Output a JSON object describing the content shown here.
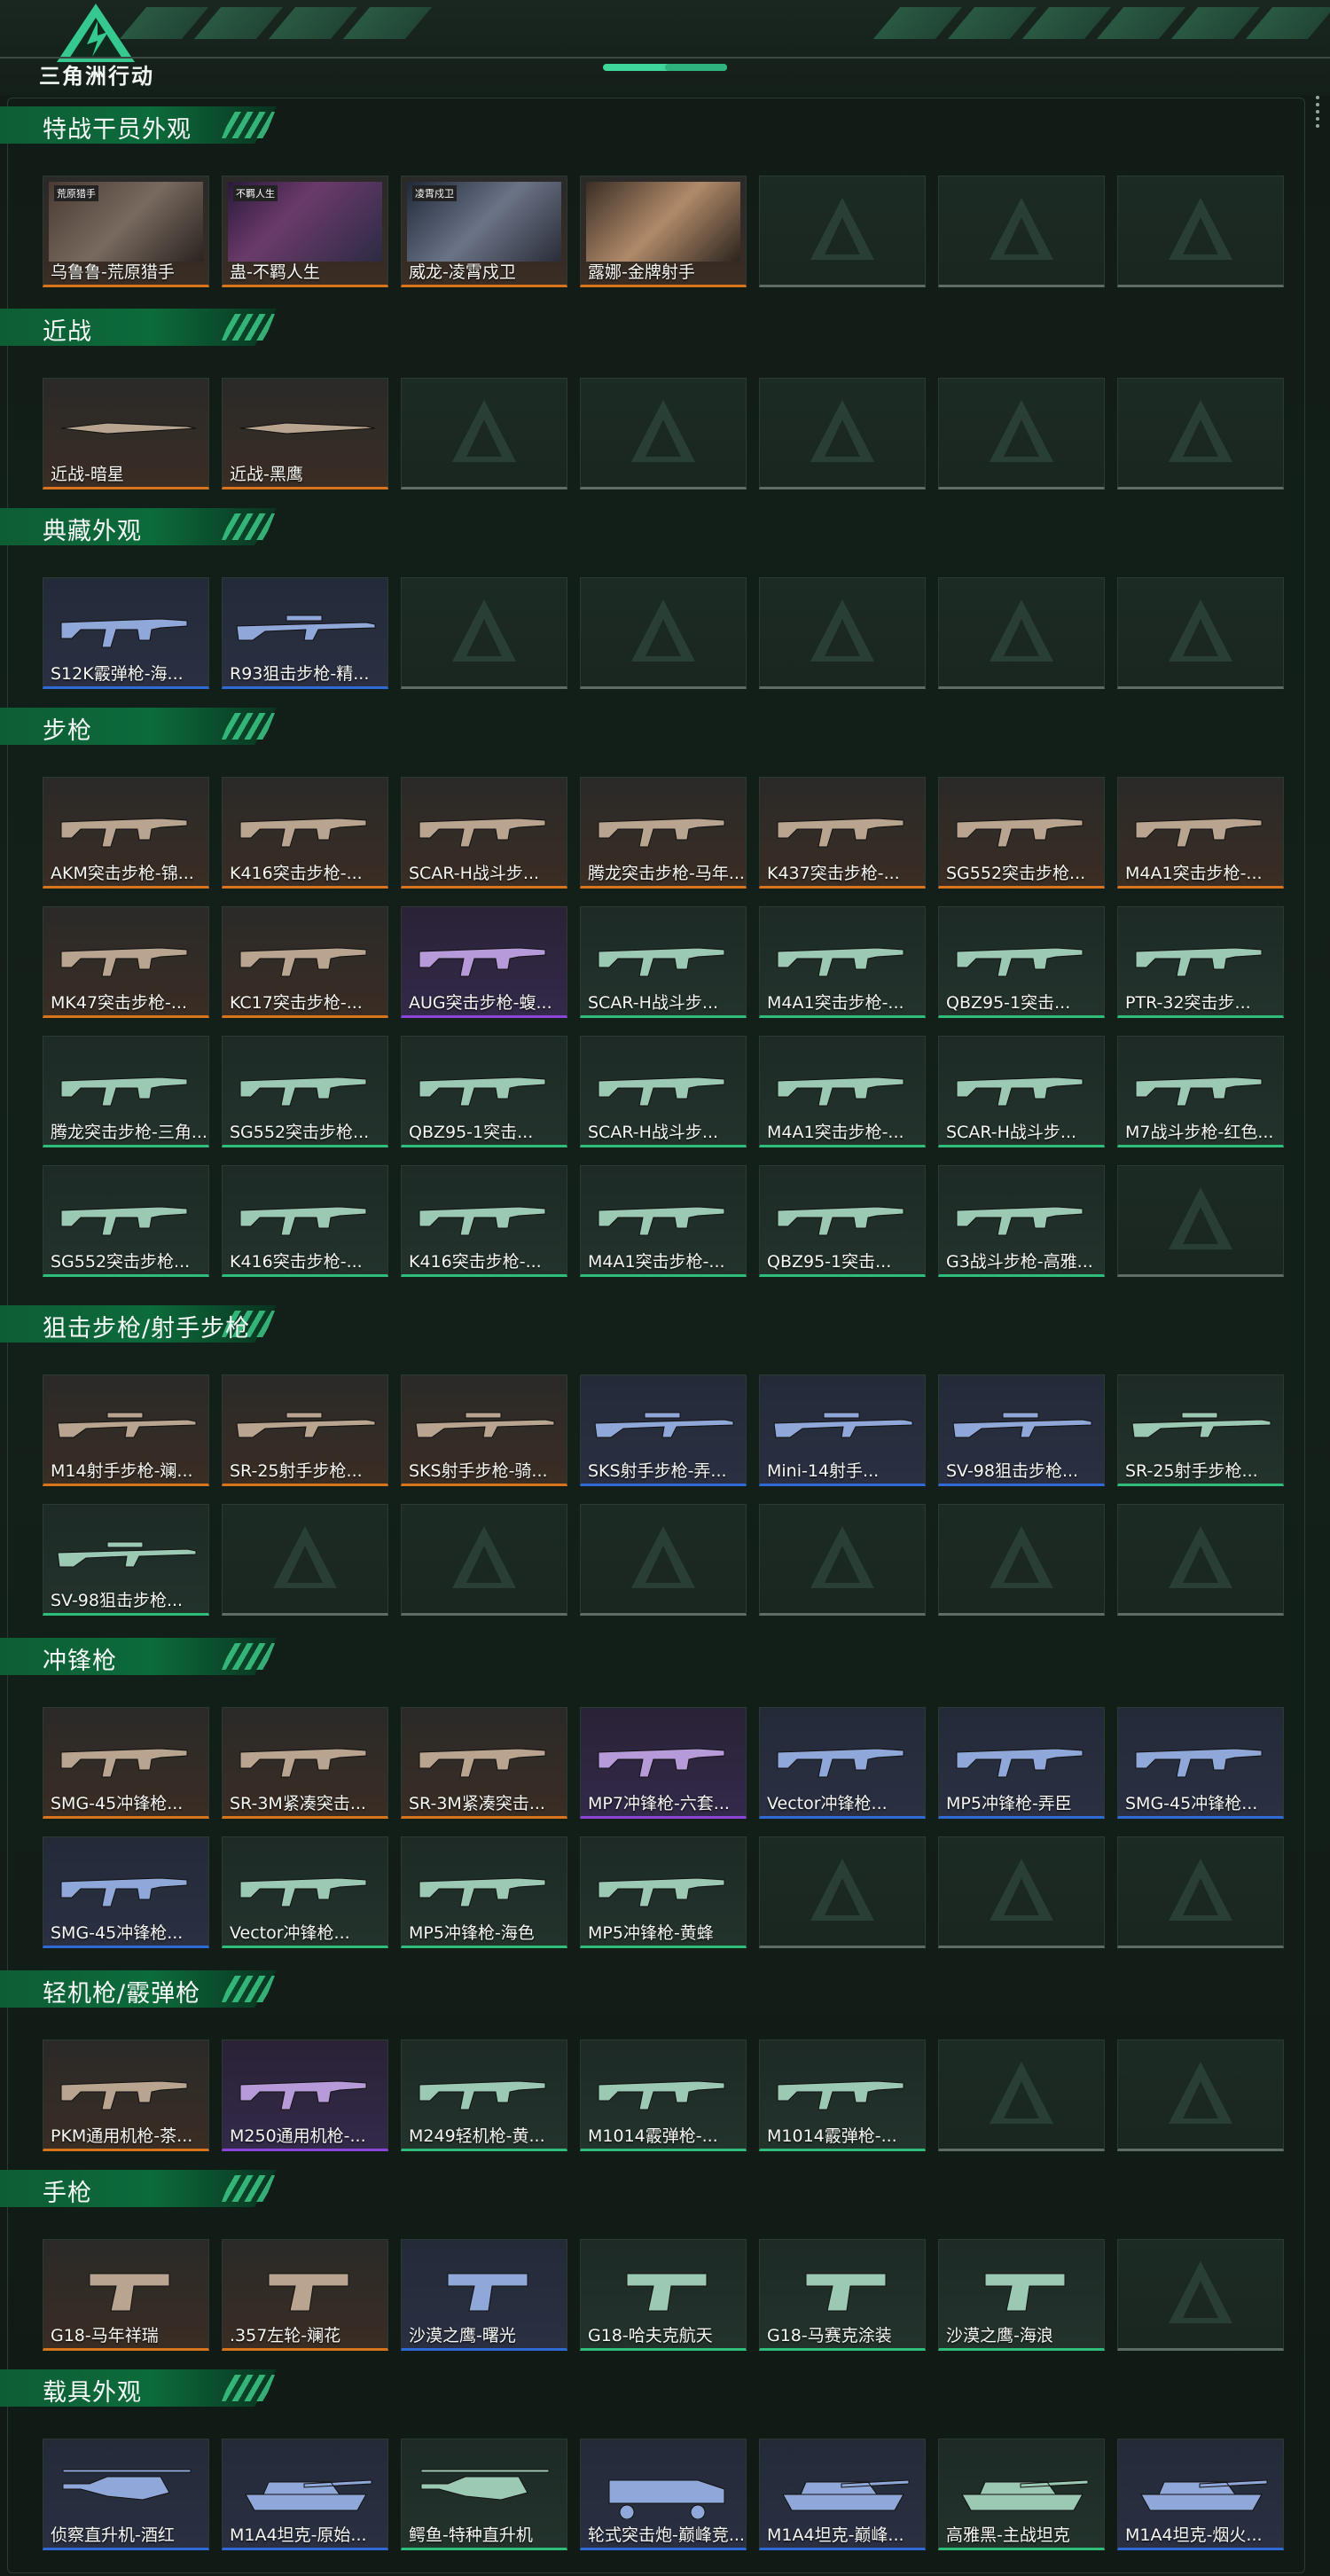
{
  "header": {
    "game_title": "三角洲行动"
  },
  "colors": {
    "orange": "#d8741c",
    "blue": "#2f6ad7",
    "green": "#2ebd7a",
    "purple": "#8b46d8",
    "accent": "#3fd69a"
  },
  "sections": [
    {
      "title": "特战干员外观",
      "items": [
        {
          "name": "乌鲁鲁-荒原猎手",
          "rarity": "orange",
          "kind": "photo",
          "badge": "荒原猎手"
        },
        {
          "name": "蛊-不羁人生",
          "rarity": "orange",
          "kind": "photo",
          "badge": "不羁人生"
        },
        {
          "name": "威龙-凌霄戍卫",
          "rarity": "orange",
          "kind": "photo",
          "badge": "凌霄戍卫"
        },
        {
          "name": "露娜-金牌射手",
          "rarity": "orange",
          "kind": "photo",
          "badge": ""
        },
        null,
        null,
        null
      ]
    },
    {
      "title": "近战",
      "items": [
        {
          "name": "近战-暗星",
          "rarity": "orange",
          "kind": "knife"
        },
        {
          "name": "近战-黑鹰",
          "rarity": "orange",
          "kind": "knife"
        },
        null,
        null,
        null,
        null,
        null
      ]
    },
    {
      "title": "典藏外观",
      "items": [
        {
          "name": "S12K霰弹枪-海...",
          "rarity": "blue",
          "kind": "gun"
        },
        {
          "name": "R93狙击步枪-精...",
          "rarity": "blue",
          "kind": "sniper"
        },
        null,
        null,
        null,
        null,
        null
      ]
    },
    {
      "title": "步枪",
      "items": [
        {
          "name": "AKM突击步枪-锦...",
          "rarity": "orange",
          "kind": "gun"
        },
        {
          "name": "K416突击步枪-...",
          "rarity": "orange",
          "kind": "gun"
        },
        {
          "name": "SCAR-H战斗步...",
          "rarity": "orange",
          "kind": "gun"
        },
        {
          "name": "腾龙突击步枪-马年...",
          "rarity": "orange",
          "kind": "gun"
        },
        {
          "name": "K437突击步枪-...",
          "rarity": "orange",
          "kind": "gun"
        },
        {
          "name": "SG552突击步枪...",
          "rarity": "orange",
          "kind": "gun"
        },
        {
          "name": "M4A1突击步枪-...",
          "rarity": "orange",
          "kind": "gun"
        },
        {
          "name": "MK47突击步枪-...",
          "rarity": "orange",
          "kind": "gun"
        },
        {
          "name": "KC17突击步枪-...",
          "rarity": "orange",
          "kind": "gun"
        },
        {
          "name": "AUG突击步枪-蝮...",
          "rarity": "purple",
          "kind": "gun"
        },
        {
          "name": "SCAR-H战斗步...",
          "rarity": "green",
          "kind": "gun"
        },
        {
          "name": "M4A1突击步枪-...",
          "rarity": "green",
          "kind": "gun"
        },
        {
          "name": "QBZ95-1突击...",
          "rarity": "green",
          "kind": "gun"
        },
        {
          "name": "PTR-32突击步...",
          "rarity": "green",
          "kind": "gun"
        },
        {
          "name": "腾龙突击步枪-三角...",
          "rarity": "green",
          "kind": "gun"
        },
        {
          "name": "SG552突击步枪...",
          "rarity": "green",
          "kind": "gun"
        },
        {
          "name": "QBZ95-1突击...",
          "rarity": "green",
          "kind": "gun"
        },
        {
          "name": "SCAR-H战斗步...",
          "rarity": "green",
          "kind": "gun"
        },
        {
          "name": "M4A1突击步枪-...",
          "rarity": "green",
          "kind": "gun"
        },
        {
          "name": "SCAR-H战斗步...",
          "rarity": "green",
          "kind": "gun"
        },
        {
          "name": "M7战斗步枪-红色...",
          "rarity": "green",
          "kind": "gun"
        },
        {
          "name": "SG552突击步枪...",
          "rarity": "green",
          "kind": "gun"
        },
        {
          "name": "K416突击步枪-...",
          "rarity": "green",
          "kind": "gun"
        },
        {
          "name": "K416突击步枪-...",
          "rarity": "green",
          "kind": "gun"
        },
        {
          "name": "M4A1突击步枪-...",
          "rarity": "green",
          "kind": "gun"
        },
        {
          "name": "QBZ95-1突击...",
          "rarity": "green",
          "kind": "gun"
        },
        {
          "name": "G3战斗步枪-高雅...",
          "rarity": "green",
          "kind": "gun"
        },
        null
      ]
    },
    {
      "title": "狙击步枪/射手步枪",
      "items": [
        {
          "name": "M14射手步枪-斓...",
          "rarity": "orange",
          "kind": "sniper"
        },
        {
          "name": "SR-25射手步枪...",
          "rarity": "orange",
          "kind": "sniper"
        },
        {
          "name": "SKS射手步枪-骑...",
          "rarity": "orange",
          "kind": "sniper"
        },
        {
          "name": "SKS射手步枪-弄...",
          "rarity": "blue",
          "kind": "sniper"
        },
        {
          "name": "Mini-14射手...",
          "rarity": "blue",
          "kind": "sniper"
        },
        {
          "name": "SV-98狙击步枪...",
          "rarity": "blue",
          "kind": "sniper"
        },
        {
          "name": "SR-25射手步枪...",
          "rarity": "green",
          "kind": "sniper"
        },
        {
          "name": "SV-98狙击步枪...",
          "rarity": "green",
          "kind": "sniper"
        },
        null,
        null,
        null,
        null,
        null,
        null
      ]
    },
    {
      "title": "冲锋枪",
      "items": [
        {
          "name": "SMG-45冲锋枪...",
          "rarity": "orange",
          "kind": "smg"
        },
        {
          "name": "SR-3M紧凑突击...",
          "rarity": "orange",
          "kind": "smg"
        },
        {
          "name": "SR-3M紧凑突击...",
          "rarity": "orange",
          "kind": "smg"
        },
        {
          "name": "MP7冲锋枪-六套...",
          "rarity": "purple",
          "kind": "smg"
        },
        {
          "name": "Vector冲锋枪...",
          "rarity": "blue",
          "kind": "smg"
        },
        {
          "name": "MP5冲锋枪-弄臣",
          "rarity": "blue",
          "kind": "smg"
        },
        {
          "name": "SMG-45冲锋枪...",
          "rarity": "blue",
          "kind": "smg"
        },
        {
          "name": "SMG-45冲锋枪...",
          "rarity": "blue",
          "kind": "smg"
        },
        {
          "name": "Vector冲锋枪...",
          "rarity": "green",
          "kind": "smg"
        },
        {
          "name": "MP5冲锋枪-海色",
          "rarity": "green",
          "kind": "smg"
        },
        {
          "name": "MP5冲锋枪-黄蜂",
          "rarity": "green",
          "kind": "smg"
        },
        null,
        null,
        null
      ]
    },
    {
      "title": "轻机枪/霰弹枪",
      "items": [
        {
          "name": "PKM通用机枪-茶...",
          "rarity": "orange",
          "kind": "gun"
        },
        {
          "name": "M250通用机枪-...",
          "rarity": "purple",
          "kind": "gun"
        },
        {
          "name": "M249轻机枪-黄...",
          "rarity": "green",
          "kind": "gun"
        },
        {
          "name": "M1014霰弹枪-...",
          "rarity": "green",
          "kind": "shotgun"
        },
        {
          "name": "M1014霰弹枪-...",
          "rarity": "green",
          "kind": "shotgun"
        },
        null,
        null
      ]
    },
    {
      "title": "手枪",
      "items": [
        {
          "name": "G18-马年祥瑞",
          "rarity": "orange",
          "kind": "pistol"
        },
        {
          "name": ".357左轮-斓花",
          "rarity": "orange",
          "kind": "pistol"
        },
        {
          "name": "沙漠之鹰-曙光",
          "rarity": "blue",
          "kind": "pistol"
        },
        {
          "name": "G18-哈夫克航天",
          "rarity": "green",
          "kind": "pistol"
        },
        {
          "name": "G18-马赛克涂装",
          "rarity": "green",
          "kind": "pistol"
        },
        {
          "name": "沙漠之鹰-海浪",
          "rarity": "green",
          "kind": "pistol"
        },
        null
      ]
    },
    {
      "title": "载具外观",
      "items": [
        {
          "name": "侦察直升机-酒红",
          "rarity": "blue",
          "kind": "heli"
        },
        {
          "name": "M1A4坦克-原始...",
          "rarity": "blue",
          "kind": "tank"
        },
        {
          "name": "鳄鱼-特种直升机",
          "rarity": "green",
          "kind": "heli"
        },
        {
          "name": "轮式突击炮-巅峰竞...",
          "rarity": "blue",
          "kind": "truck"
        },
        {
          "name": "M1A4坦克-巅峰...",
          "rarity": "blue",
          "kind": "tank"
        },
        {
          "name": "高雅黑-主战坦克",
          "rarity": "green",
          "kind": "tank"
        },
        {
          "name": "M1A4坦克-烟火...",
          "rarity": "blue",
          "kind": "tank"
        }
      ]
    }
  ]
}
